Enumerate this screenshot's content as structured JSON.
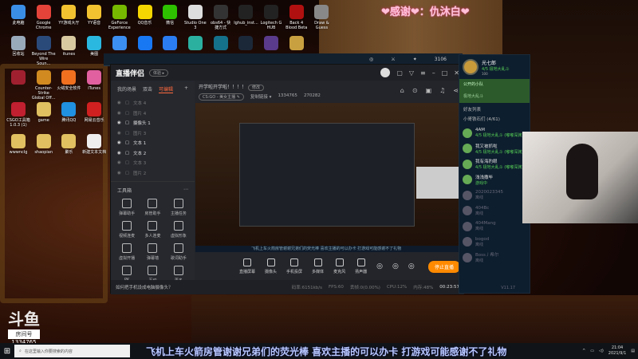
{
  "desktop": {
    "icons": [
      {
        "label": "此电脑",
        "color": "#3a8ee6"
      },
      {
        "label": "Google Chrome",
        "color": "#e4433a"
      },
      {
        "label": "YY游戏大厅",
        "color": "#f2c230"
      },
      {
        "label": "YY语音",
        "color": "#f2c230"
      },
      {
        "label": "GeForce Experience",
        "color": "#76b900"
      },
      {
        "label": "QQ音乐",
        "color": "#f6d600"
      },
      {
        "label": "微信",
        "color": "#2dc100"
      },
      {
        "label": "Studio One 3",
        "color": "#ddd"
      },
      {
        "label": "obs64 - 快捷方式",
        "color": "#333"
      },
      {
        "label": "lghub_inst...",
        "color": "#222"
      },
      {
        "label": "Logitech G HUB",
        "color": "#222"
      },
      {
        "label": "Back 4 Blood Beta",
        "color": "#b01010"
      },
      {
        "label": "Draw & Guess",
        "color": "#888"
      },
      {
        "label": "回收站",
        "color": "#9ab"
      },
      {
        "label": "Beyond The Wire Soun...",
        "color": "#2a4a7a"
      },
      {
        "label": "itunes",
        "color": "#d9c9a0"
      },
      {
        "label": "美图",
        "color": "#2ab8e0"
      },
      {
        "label": "",
        "color": "#3c8ef0"
      },
      {
        "label": "",
        "color": "#1877f2"
      },
      {
        "label": "",
        "color": "#2a7cf0"
      },
      {
        "label": "",
        "color": "#2bb0a0"
      },
      {
        "label": "",
        "color": "#15708a"
      },
      {
        "label": "",
        "color": "#1b2838"
      },
      {
        "label": "",
        "color": "#5a3a8a"
      },
      {
        "label": "",
        "color": "#c8a040"
      },
      {
        "label": "",
        "color": "#a02030"
      },
      {
        "label": "Counter-Strike Global Off...",
        "color": "#d08a20"
      },
      {
        "label": "火绒安全软件",
        "color": "#f07020"
      },
      {
        "label": "iTunes",
        "color": "#e060a0"
      },
      {
        "label": "CSGO工具箱 1.0.3 (1)",
        "color": "#c02030"
      },
      {
        "label": "game",
        "color": "#e0c060"
      },
      {
        "label": "腾讯QQ",
        "color": "#2090e0"
      },
      {
        "label": "网易云音乐",
        "color": "#d02020"
      },
      {
        "label": "wwwnclg",
        "color": "#e0c060"
      },
      {
        "label": "shaopian",
        "color": "#e0c060"
      },
      {
        "label": "聚乐",
        "color": "#e0c060"
      },
      {
        "label": "新建文本文档",
        "color": "#eee"
      }
    ]
  },
  "overlay_thanks": "❤感谢❤：仇沐白❤",
  "behind_window": {
    "score": "3106"
  },
  "app": {
    "title": "直播伴侣",
    "badge": "体验 ▸",
    "tabs": [
      "我的场景",
      "双击",
      "可编辑"
    ],
    "add": "+",
    "layers": [
      {
        "name": "文本 4",
        "visible": false
      },
      {
        "name": "图片 4",
        "visible": false
      },
      {
        "name": "摄像头 1",
        "visible": true
      },
      {
        "name": "图片 3",
        "visible": false
      },
      {
        "name": "文本 1",
        "visible": true
      },
      {
        "name": "文本 2",
        "visible": true
      },
      {
        "name": "文本 3",
        "visible": false
      },
      {
        "name": "图片 2",
        "visible": false
      }
    ],
    "tools_title": "工具箱",
    "tools": [
      "弹幕助手",
      "房管助手",
      "主播任务",
      "视频连麦",
      "多人连麦",
      "虚拟形象",
      "虚拟开播",
      "弹幕墙",
      "歌词助手",
      "PK",
      "互动",
      "更多"
    ],
    "stream_title": "开学啦开学啦！！！！",
    "edit": "修改",
    "category": "CS:GO - 美女主播 ✎",
    "share": "复制链接 ▾",
    "room_id": "1334765",
    "hot": "270282",
    "preview_ticker": "飞机上车火箭房管谢谢兄弟们的荧光棒 喜欢主播的可以办卡 打游戏可能感谢不了礼物",
    "controls": [
      "直播屏幕",
      "摄像头",
      "手机投屏",
      "多媒体",
      "麦克风",
      "扬声器"
    ],
    "stop": "停止直播",
    "tip": "如何把手机设成电脑摄像头？",
    "stats": [
      "码率:6151kb/s",
      "FPS:60",
      "丢帧:0(0.00%)",
      "CPU:12%",
      "内存:48%"
    ],
    "elapsed": "00:23:57"
  },
  "friends": {
    "username": "光七郎",
    "status": "4/5 极地大乱斗",
    "level": "100",
    "team_title": "公开的小队",
    "team_sub": "极地大乱斗",
    "list_title": "好友列表",
    "group": "小哥铁石们 (4/61)",
    "items": [
      {
        "name": "4AM",
        "status": "4/5 极地大乱斗 (嘟嘟深渊)",
        "online": true
      },
      {
        "name": "我又被抓啦",
        "status": "4/5 极地大乱斗 (嘟嘟深渊)",
        "online": true
      },
      {
        "name": "我有海豹眼",
        "status": "4/5 极地大乱斗 (嘟嘟深渊)",
        "online": true
      },
      {
        "name": "浅浅撒毕",
        "status": "游戏中",
        "online": true
      },
      {
        "name": "2020023345",
        "status": "离线",
        "online": false
      },
      {
        "name": "404Bc",
        "status": "离线",
        "online": false
      },
      {
        "name": "404Mang",
        "status": "离线",
        "online": false
      },
      {
        "name": "bogod",
        "status": "离线",
        "online": false
      },
      {
        "name": "Boss丿希尔",
        "status": "离线",
        "online": false
      }
    ],
    "version": "V11.17"
  },
  "douyu": {
    "logo": "斗鱼",
    "room_label": "房间号",
    "room": "1334765"
  },
  "taskbar": {
    "search_placeholder": "在这里输入你要搜索的内容",
    "danmu": "飞机上车火箭房管谢谢兄弟们的荧光棒 喜欢主播的可以办卡 打游戏可能感谢不了礼物",
    "time": "21:04",
    "date": "2021/9/1"
  }
}
